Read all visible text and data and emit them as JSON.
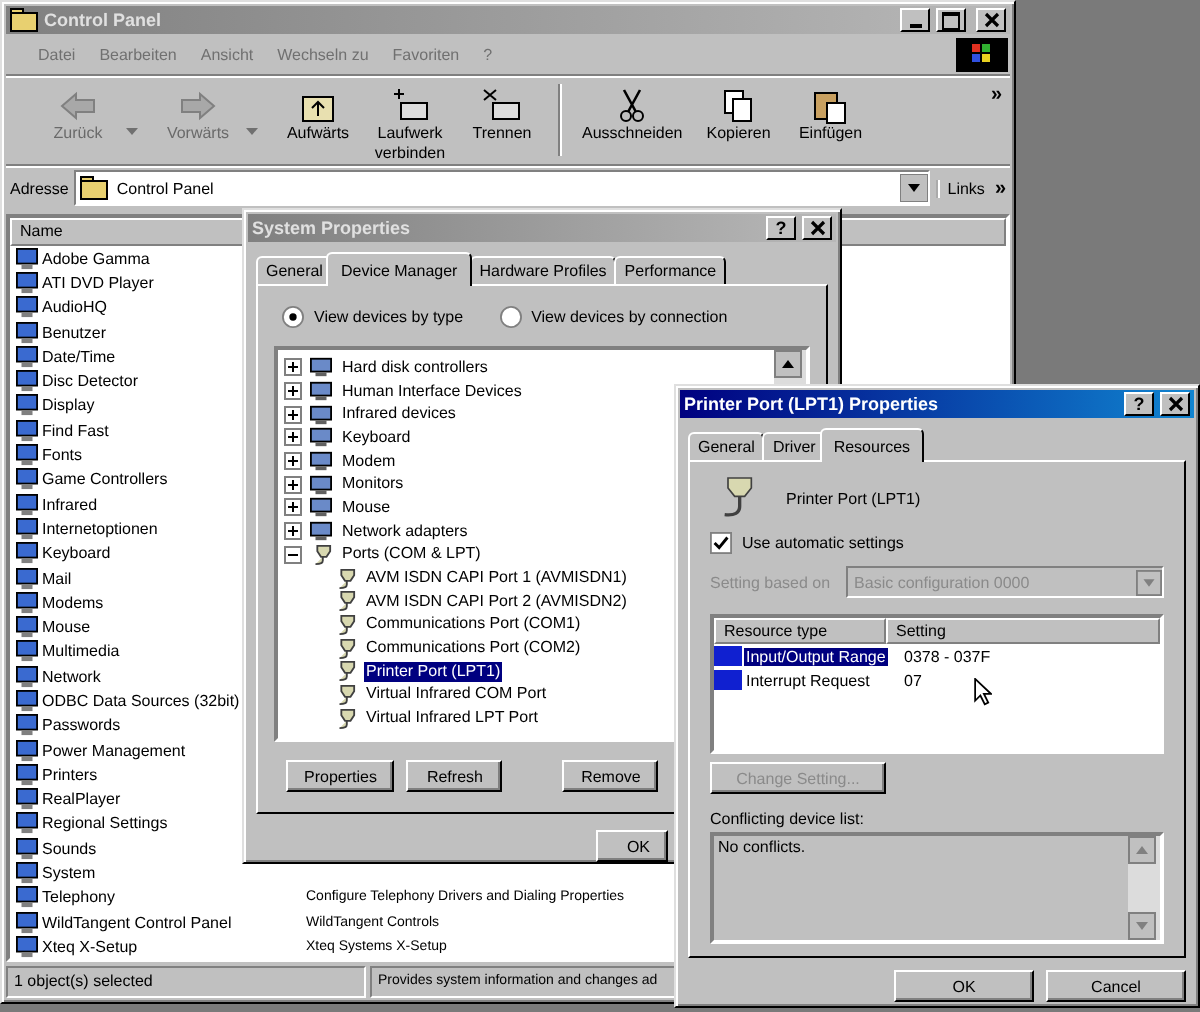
{
  "explorer": {
    "title": "Control Panel",
    "active": false,
    "menu": [
      "Datei",
      "Bearbeiten",
      "Ansicht",
      "Wechseln zu",
      "Favoriten",
      "?"
    ],
    "toolbar": [
      {
        "label": "Zurück",
        "kind": "back",
        "disabled": true,
        "dropdown": true
      },
      {
        "label": "Vorwärts",
        "kind": "forward",
        "disabled": true,
        "dropdown": true
      },
      {
        "label": "Aufwärts",
        "kind": "up",
        "disabled": false,
        "dropdown": false
      },
      {
        "label": "Laufwerk verbinden",
        "kind": "map",
        "disabled": false,
        "dropdown": false
      },
      {
        "label": "Trennen",
        "kind": "disconnect",
        "disabled": false,
        "dropdown": false
      },
      {
        "label": "Ausschneiden",
        "kind": "cut",
        "disabled": false,
        "dropdown": false
      },
      {
        "label": "Kopieren",
        "kind": "copy",
        "disabled": false,
        "dropdown": false
      },
      {
        "label": "Einfügen",
        "kind": "paste",
        "disabled": false,
        "dropdown": false
      }
    ],
    "toolbar_more": "»",
    "address": {
      "label": "Adresse",
      "value": "Control Panel"
    },
    "links": {
      "label": "Links",
      "more": "»"
    },
    "list": {
      "header": "Name",
      "items": [
        {
          "name": "Adobe Gamma"
        },
        {
          "name": "ATI DVD Player"
        },
        {
          "name": "AudioHQ"
        },
        {
          "name": "Benutzer"
        },
        {
          "name": "Date/Time"
        },
        {
          "name": "Disc Detector"
        },
        {
          "name": "Display"
        },
        {
          "name": "Find Fast"
        },
        {
          "name": "Fonts"
        },
        {
          "name": "Game Controllers"
        },
        {
          "name": "Infrared"
        },
        {
          "name": "Internetoptionen"
        },
        {
          "name": "Keyboard"
        },
        {
          "name": "Mail"
        },
        {
          "name": "Modems"
        },
        {
          "name": "Mouse"
        },
        {
          "name": "Multimedia"
        },
        {
          "name": "Network"
        },
        {
          "name": "ODBC Data Sources (32bit)"
        },
        {
          "name": "Passwords"
        },
        {
          "name": "Power Management"
        },
        {
          "name": "Printers"
        },
        {
          "name": "RealPlayer"
        },
        {
          "name": "Regional Settings"
        },
        {
          "name": "Sounds"
        },
        {
          "name": "System"
        },
        {
          "name": "Telephony",
          "description": "Configure Telephony Drivers and Dialing Properties"
        },
        {
          "name": "WildTangent Control Panel",
          "description": "WildTangent Controls"
        },
        {
          "name": "Xteq X-Setup",
          "description": "Xteq Systems X-Setup"
        }
      ]
    },
    "status_bar": [
      "1 object(s) selected",
      "Provides system information and changes ad"
    ]
  },
  "system_properties": {
    "title": "System Properties",
    "active": false,
    "help": "?",
    "tabs": [
      {
        "label": "General",
        "selected": false
      },
      {
        "label": "Device Manager",
        "selected": true
      },
      {
        "label": "Hardware Profiles",
        "selected": false
      },
      {
        "label": "Performance",
        "selected": false
      }
    ],
    "view_options": [
      {
        "label": "View devices by type",
        "selected": true
      },
      {
        "label": "View devices by connection",
        "selected": false
      }
    ],
    "tree": [
      {
        "label": "Hard disk controllers",
        "expanded": false
      },
      {
        "label": "Human Interface Devices",
        "expanded": false
      },
      {
        "label": "Infrared devices",
        "expanded": false
      },
      {
        "label": "Keyboard",
        "expanded": false
      },
      {
        "label": "Modem",
        "expanded": false
      },
      {
        "label": "Monitors",
        "expanded": false
      },
      {
        "label": "Mouse",
        "expanded": false
      },
      {
        "label": "Network adapters",
        "expanded": false
      },
      {
        "label": "Ports (COM & LPT)",
        "expanded": true,
        "children": [
          {
            "label": "AVM ISDN CAPI Port 1 (AVMISDN1)",
            "selected": false
          },
          {
            "label": "AVM ISDN CAPI Port 2 (AVMISDN2)",
            "selected": false
          },
          {
            "label": "Communications Port (COM1)",
            "selected": false
          },
          {
            "label": "Communications Port (COM2)",
            "selected": false
          },
          {
            "label": "Printer Port (LPT1)",
            "selected": true
          },
          {
            "label": "Virtual Infrared COM Port",
            "selected": false
          },
          {
            "label": "Virtual Infrared LPT Port",
            "selected": false
          }
        ]
      }
    ],
    "buttons": [
      "Properties",
      "Refresh",
      "Remove"
    ],
    "ok": "OK"
  },
  "printer_port": {
    "title": "Printer Port (LPT1) Properties",
    "active": true,
    "help": "?",
    "tabs": [
      {
        "label": "General",
        "selected": false
      },
      {
        "label": "Driver",
        "selected": false
      },
      {
        "label": "Resources",
        "selected": true
      }
    ],
    "device_name": "Printer Port (LPT1)",
    "auto_settings": {
      "label": "Use automatic settings",
      "checked": true
    },
    "setting_based_on": {
      "label": "Setting based on",
      "value": "Basic configuration 0000",
      "disabled": true
    },
    "resources": {
      "columns": [
        "Resource type",
        "Setting"
      ],
      "rows": [
        {
          "type": "Input/Output Range",
          "setting": "0378 - 037F",
          "selected": true
        },
        {
          "type": "Interrupt Request",
          "setting": "07",
          "selected": false
        }
      ]
    },
    "change_button": {
      "label": "Change Setting...",
      "disabled": true
    },
    "conflicts_label": "Conflicting device list:",
    "conflicts_text": "No conflicts.",
    "buttons": [
      "OK",
      "Cancel"
    ]
  }
}
